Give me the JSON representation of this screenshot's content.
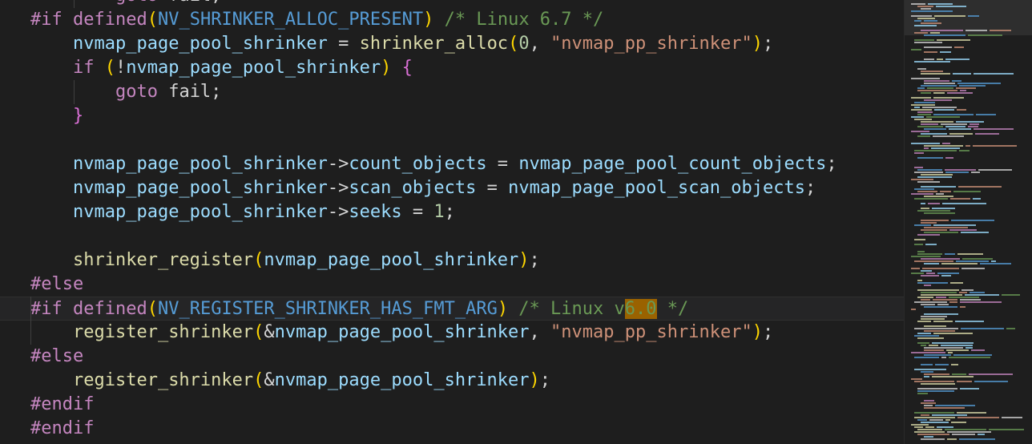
{
  "colors": {
    "background": "#1e1e1e",
    "keyword": "#c586c0",
    "function": "#dcdcaa",
    "variable": "#9cdcfe",
    "number": "#b5cea8",
    "string": "#ce9178",
    "comment": "#6a9955",
    "macro": "#569cd6",
    "paren": "#ffd700",
    "brace": "#da70d6",
    "highlight": "#9a6200"
  },
  "code": {
    "lines": [
      {
        "indent": "        ",
        "tokens": [
          {
            "t": "goto",
            "c": "kw"
          },
          {
            "t": " fail;",
            "c": "punct"
          }
        ]
      },
      {
        "indent": "",
        "tokens": [
          {
            "t": "#if",
            "c": "kw"
          },
          {
            "t": " ",
            "c": "punct"
          },
          {
            "t": "defined",
            "c": "kw"
          },
          {
            "t": "(",
            "c": "paren"
          },
          {
            "t": "NV_SHRINKER_ALLOC_PRESENT",
            "c": "macro"
          },
          {
            "t": ")",
            "c": "paren"
          },
          {
            "t": " /* Linux 6.7 */",
            "c": "cmt"
          }
        ]
      },
      {
        "indent": "    ",
        "tokens": [
          {
            "t": "nvmap_page_pool_shrinker",
            "c": "var"
          },
          {
            "t": " = ",
            "c": "punct"
          },
          {
            "t": "shrinker_alloc",
            "c": "fn"
          },
          {
            "t": "(",
            "c": "paren"
          },
          {
            "t": "0",
            "c": "num"
          },
          {
            "t": ", ",
            "c": "punct"
          },
          {
            "t": "\"nvmap_pp_shrinker\"",
            "c": "str"
          },
          {
            "t": ")",
            "c": "paren"
          },
          {
            "t": ";",
            "c": "punct"
          }
        ]
      },
      {
        "indent": "    ",
        "tokens": [
          {
            "t": "if",
            "c": "kw"
          },
          {
            "t": " ",
            "c": "punct"
          },
          {
            "t": "(",
            "c": "paren"
          },
          {
            "t": "!",
            "c": "punct"
          },
          {
            "t": "nvmap_page_pool_shrinker",
            "c": "var"
          },
          {
            "t": ")",
            "c": "paren"
          },
          {
            "t": " ",
            "c": "punct"
          },
          {
            "t": "{",
            "c": "brace"
          }
        ]
      },
      {
        "indent": "        ",
        "tokens": [
          {
            "t": "goto",
            "c": "kw"
          },
          {
            "t": " fail;",
            "c": "punct"
          }
        ]
      },
      {
        "indent": "    ",
        "tokens": [
          {
            "t": "}",
            "c": "brace"
          }
        ]
      },
      {
        "indent": "",
        "tokens": []
      },
      {
        "indent": "    ",
        "tokens": [
          {
            "t": "nvmap_page_pool_shrinker",
            "c": "var"
          },
          {
            "t": "->",
            "c": "punct"
          },
          {
            "t": "count_objects",
            "c": "var"
          },
          {
            "t": " = ",
            "c": "punct"
          },
          {
            "t": "nvmap_page_pool_count_objects",
            "c": "var"
          },
          {
            "t": ";",
            "c": "punct"
          }
        ]
      },
      {
        "indent": "    ",
        "tokens": [
          {
            "t": "nvmap_page_pool_shrinker",
            "c": "var"
          },
          {
            "t": "->",
            "c": "punct"
          },
          {
            "t": "scan_objects",
            "c": "var"
          },
          {
            "t": " = ",
            "c": "punct"
          },
          {
            "t": "nvmap_page_pool_scan_objects",
            "c": "var"
          },
          {
            "t": ";",
            "c": "punct"
          }
        ]
      },
      {
        "indent": "    ",
        "tokens": [
          {
            "t": "nvmap_page_pool_shrinker",
            "c": "var"
          },
          {
            "t": "->",
            "c": "punct"
          },
          {
            "t": "seeks",
            "c": "var"
          },
          {
            "t": " = ",
            "c": "punct"
          },
          {
            "t": "1",
            "c": "num"
          },
          {
            "t": ";",
            "c": "punct"
          }
        ]
      },
      {
        "indent": "",
        "tokens": []
      },
      {
        "indent": "    ",
        "tokens": [
          {
            "t": "shrinker_register",
            "c": "fn"
          },
          {
            "t": "(",
            "c": "paren"
          },
          {
            "t": "nvmap_page_pool_shrinker",
            "c": "var"
          },
          {
            "t": ")",
            "c": "paren"
          },
          {
            "t": ";",
            "c": "punct"
          }
        ]
      },
      {
        "indent": "",
        "tokens": [
          {
            "t": "#else",
            "c": "kw"
          }
        ]
      },
      {
        "indent": "",
        "current": true,
        "tokens": [
          {
            "t": "#if",
            "c": "kw"
          },
          {
            "t": " ",
            "c": "punct"
          },
          {
            "t": "defined",
            "c": "kw"
          },
          {
            "t": "(",
            "c": "paren"
          },
          {
            "t": "NV_REGISTER_SHRINKER_HAS_FMT_ARG",
            "c": "macro"
          },
          {
            "t": ")",
            "c": "paren"
          },
          {
            "t": " /* Linux v",
            "c": "cmt"
          },
          {
            "t": "6.0",
            "c": "hl"
          },
          {
            "t": " */",
            "c": "cmt"
          }
        ]
      },
      {
        "indent": "    ",
        "tokens": [
          {
            "t": "register_shrinker",
            "c": "fn"
          },
          {
            "t": "(",
            "c": "paren"
          },
          {
            "t": "&",
            "c": "punct"
          },
          {
            "t": "nvmap_page_pool_shrinker",
            "c": "var"
          },
          {
            "t": ", ",
            "c": "punct"
          },
          {
            "t": "\"nvmap_pp_shrinker\"",
            "c": "str"
          },
          {
            "t": ")",
            "c": "paren"
          },
          {
            "t": ";",
            "c": "punct"
          }
        ]
      },
      {
        "indent": "",
        "tokens": [
          {
            "t": "#else",
            "c": "kw"
          }
        ]
      },
      {
        "indent": "    ",
        "tokens": [
          {
            "t": "register_shrinker",
            "c": "fn"
          },
          {
            "t": "(",
            "c": "paren"
          },
          {
            "t": "&",
            "c": "punct"
          },
          {
            "t": "nvmap_page_pool_shrinker",
            "c": "var"
          },
          {
            "t": ")",
            "c": "paren"
          },
          {
            "t": ";",
            "c": "punct"
          }
        ]
      },
      {
        "indent": "",
        "tokens": [
          {
            "t": "#endif",
            "c": "kw"
          }
        ]
      },
      {
        "indent": "",
        "tokens": [
          {
            "t": "#endif",
            "c": "kw"
          }
        ]
      }
    ]
  }
}
